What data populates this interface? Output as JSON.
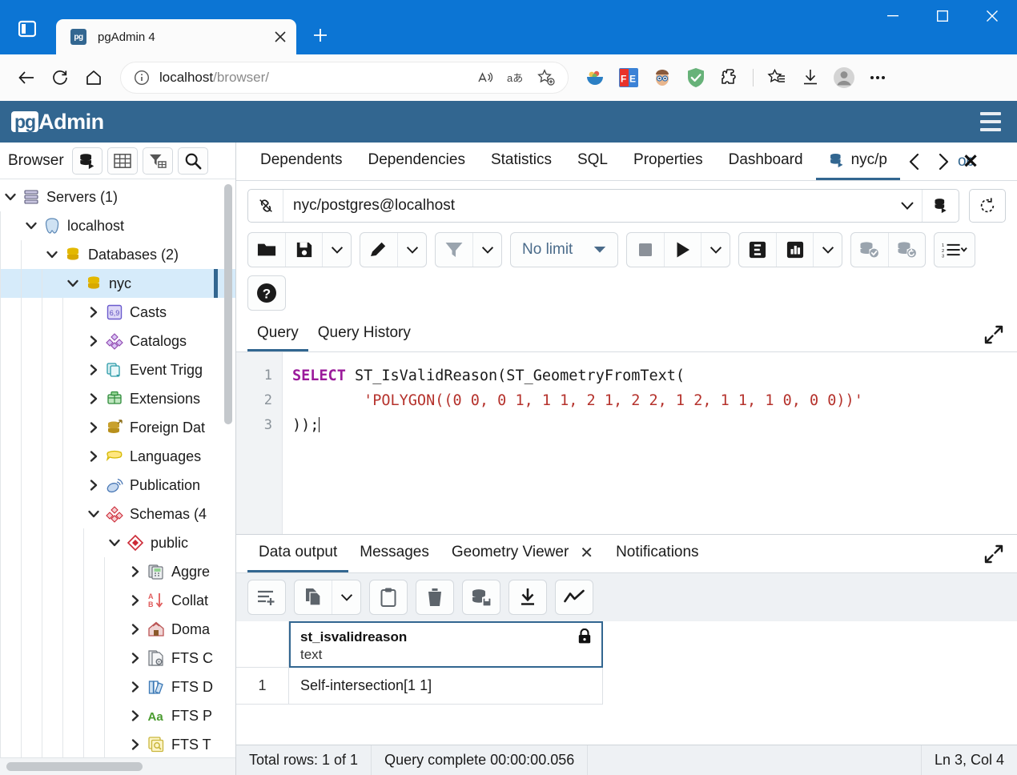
{
  "browser": {
    "tab": {
      "title": "pgAdmin 4",
      "favicon_label": "pg",
      "close_icon": "close-icon"
    },
    "new_tab_label": "+",
    "window_controls": {
      "minimize": "minimize-icon",
      "maximize": "maximize-icon",
      "close": "close-icon"
    },
    "nav": {
      "back": "back-arrow-icon",
      "refresh": "refresh-icon",
      "home": "home-icon"
    },
    "omnibox": {
      "info_icon": "info-icon",
      "url_host": "localhost",
      "url_path": "/browser/",
      "read_aloud": "read-aloud-icon",
      "translate": "translate-icon",
      "favorite": "add-favorite-icon"
    },
    "extensions": [
      "fruit-bowl-icon",
      "fe-extension-icon",
      "face-extension-icon",
      "adguard-shield-icon",
      "puzzle-extension-icon"
    ],
    "actions": {
      "collections": "favorites-collections-icon",
      "downloads": "downloads-icon",
      "profile": "profile-avatar-icon",
      "settings": "more-options-icon"
    }
  },
  "app": {
    "logo_box": "pg",
    "logo_text": "Admin",
    "menu_icon": "hamburger-menu-icon"
  },
  "sidebar": {
    "title": "Browser",
    "tools": [
      "object-explorer-icon",
      "grid-table-icon",
      "filter-table-icon",
      "search-icon"
    ],
    "tree": [
      {
        "label": "Servers (1)",
        "depth": 0,
        "state": "expanded",
        "icon": "servers-icon",
        "selected": false
      },
      {
        "label": "localhost",
        "depth": 1,
        "state": "expanded",
        "icon": "postgresql-icon",
        "selected": false
      },
      {
        "label": "Databases (2)",
        "depth": 2,
        "state": "expanded",
        "icon": "databases-icon",
        "selected": false
      },
      {
        "label": "nyc",
        "depth": 3,
        "state": "expanded",
        "icon": "database-icon",
        "selected": true
      },
      {
        "label": "Casts",
        "depth": 4,
        "state": "collapsed",
        "icon": "casts-icon",
        "selected": false
      },
      {
        "label": "Catalogs",
        "depth": 4,
        "state": "collapsed",
        "icon": "catalogs-icon",
        "selected": false
      },
      {
        "label": "Event Trigg",
        "depth": 4,
        "state": "collapsed",
        "icon": "event-triggers-icon",
        "selected": false
      },
      {
        "label": "Extensions",
        "depth": 4,
        "state": "collapsed",
        "icon": "extensions-icon",
        "selected": false
      },
      {
        "label": "Foreign Dat",
        "depth": 4,
        "state": "collapsed",
        "icon": "foreign-data-wrappers-icon",
        "selected": false
      },
      {
        "label": "Languages",
        "depth": 4,
        "state": "collapsed",
        "icon": "languages-icon",
        "selected": false
      },
      {
        "label": "Publication",
        "depth": 4,
        "state": "collapsed",
        "icon": "publications-icon",
        "selected": false
      },
      {
        "label": "Schemas (4",
        "depth": 4,
        "state": "expanded",
        "icon": "schemas-icon",
        "selected": false
      },
      {
        "label": "public",
        "depth": 5,
        "state": "expanded",
        "icon": "schema-icon",
        "selected": false
      },
      {
        "label": "Aggre",
        "depth": 6,
        "state": "collapsed",
        "icon": "aggregates-icon",
        "selected": false
      },
      {
        "label": "Collat",
        "depth": 6,
        "state": "collapsed",
        "icon": "collations-icon",
        "selected": false
      },
      {
        "label": "Doma",
        "depth": 6,
        "state": "collapsed",
        "icon": "domains-icon",
        "selected": false
      },
      {
        "label": "FTS C",
        "depth": 6,
        "state": "collapsed",
        "icon": "fts-configurations-icon",
        "selected": false
      },
      {
        "label": "FTS D",
        "depth": 6,
        "state": "collapsed",
        "icon": "fts-dictionaries-icon",
        "selected": false
      },
      {
        "label": "FTS P",
        "depth": 6,
        "state": "collapsed",
        "icon": "fts-parsers-icon",
        "selected": false
      },
      {
        "label": "FTS T",
        "depth": 6,
        "state": "collapsed",
        "icon": "fts-templates-icon",
        "selected": false
      }
    ]
  },
  "object_tabs": {
    "items": [
      "Dashboard",
      "Properties",
      "SQL",
      "Statistics",
      "Dependencies",
      "Dependents"
    ],
    "active_tab": {
      "label": "nyc/p",
      "icon": "query-tool-icon"
    },
    "prev_icon": "chevron-left-icon",
    "next_icon": "chevron-right-icon",
    "close_icon": "close-icon",
    "close_ghost_text": "oc"
  },
  "connection": {
    "pin_icon": "connection-link-icon",
    "value": "nyc/postgres@localhost",
    "caret_icon": "chevron-down-icon",
    "db_icon": "database-stack-icon",
    "reset_icon": "reset-connection-icon"
  },
  "query_toolbar": {
    "open_file": "open-file-icon",
    "save_file": "save-file-icon",
    "save_caret": "chevron-down-icon",
    "edit": "edit-pencil-icon",
    "edit_caret": "chevron-down-icon",
    "filter": "filter-icon",
    "filter_caret": "chevron-down-icon",
    "row_limit_label": "No limit",
    "row_limit_caret": "dropdown-caret-icon",
    "stop": "stop-query-icon",
    "execute": "execute-query-icon",
    "execute_caret": "chevron-down-icon",
    "explain": "explain-icon",
    "explain_analyze": "explain-analyze-icon",
    "explain_caret": "chevron-down-icon",
    "commit": "commit-icon",
    "rollback": "rollback-icon",
    "macros": "macros-list-icon",
    "macros_caret": "chevron-down-icon",
    "help": "help-icon"
  },
  "query_panel": {
    "tabs": [
      "Query",
      "Query History"
    ],
    "active": "Query",
    "expand_icon": "expand-panel-icon",
    "lines": [
      {
        "num": "1",
        "tokens": [
          {
            "t": "SELECT",
            "c": "kw"
          },
          {
            "t": " ST_IsValidReason(ST_GeometryFromText(",
            "c": "fn"
          }
        ]
      },
      {
        "num": "2",
        "tokens": [
          {
            "t": "        ",
            "c": "fn"
          },
          {
            "t": "'POLYGON((0 0, 0 1, 1 1, 2 1, 2 2, 1 2, 1 1, 1 0, 0 0))'",
            "c": "str"
          }
        ]
      },
      {
        "num": "3",
        "tokens": [
          {
            "t": "));",
            "c": "fn"
          }
        ]
      }
    ]
  },
  "output_panel": {
    "tabs": [
      {
        "label": "Data output",
        "closable": false
      },
      {
        "label": "Messages",
        "closable": false
      },
      {
        "label": "Geometry Viewer",
        "closable": true
      },
      {
        "label": "Notifications",
        "closable": false
      }
    ],
    "active": "Data output",
    "expand_icon": "expand-panel-icon",
    "toolbar": {
      "add_row": "add-row-icon",
      "copy": "copy-icon",
      "copy_caret": "chevron-down-icon",
      "paste": "paste-icon",
      "delete": "delete-row-icon",
      "save_data": "save-data-changes-icon",
      "download": "download-csv-icon",
      "graph": "graph-visualiser-icon"
    },
    "grid": {
      "columns": [
        {
          "name": "st_isvalidreason",
          "type": "text",
          "lock_icon": "lock-icon"
        }
      ],
      "rows": [
        {
          "num": "1",
          "cells": [
            "Self-intersection[1 1]"
          ]
        }
      ]
    }
  },
  "status_bar": {
    "total_rows": "Total rows: 1 of 1",
    "query_time": "Query complete 00:00:00.056",
    "cursor_position": "Ln 3, Col 4"
  },
  "colors": {
    "edge_blue": "#0c75d4",
    "pg_header": "#326690",
    "accent": "#326690",
    "selection": "#d6ebfa"
  }
}
